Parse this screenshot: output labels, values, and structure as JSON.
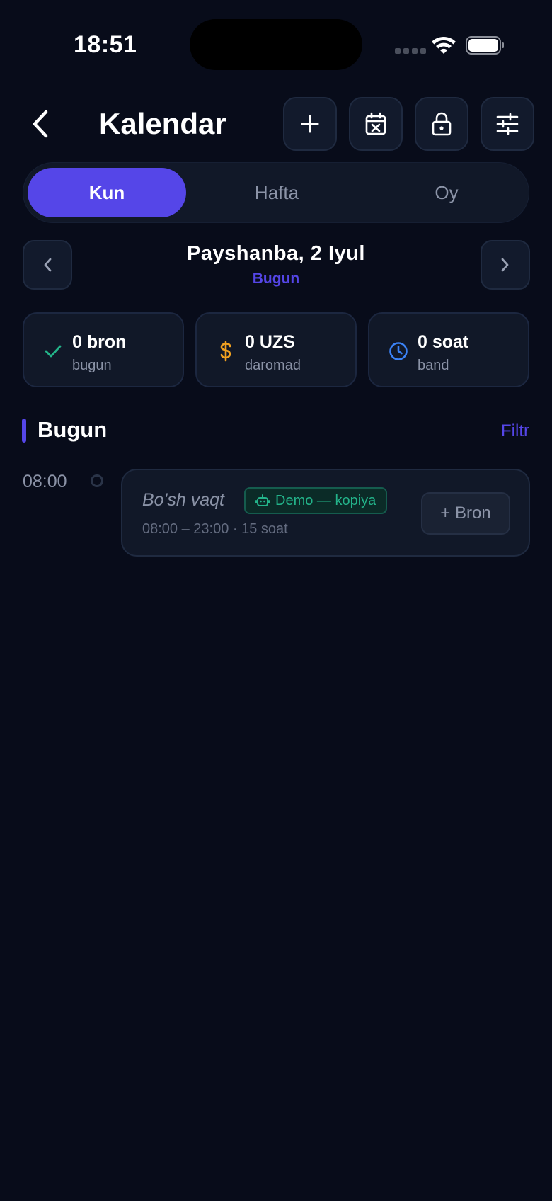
{
  "status_bar": {
    "time": "18:51"
  },
  "header": {
    "title": "Kalendar",
    "icons": [
      "back-chevron-icon",
      "plus-icon",
      "calendar-x-icon",
      "lock-icon",
      "sliders-icon"
    ]
  },
  "tabs": [
    {
      "label": "Kun",
      "active": true
    },
    {
      "label": "Hafta",
      "active": false
    },
    {
      "label": "Oy",
      "active": false
    }
  ],
  "date_nav": {
    "date": "Payshanba, 2 Iyul",
    "relative": "Bugun"
  },
  "stats": [
    {
      "value": "0 bron",
      "label": "bugun",
      "icon": "check-icon",
      "color": "#23b48a"
    },
    {
      "value": "0 UZS",
      "label": "daromad",
      "icon": "dollar-icon",
      "color": "#f0a020"
    },
    {
      "value": "0 soat",
      "label": "band",
      "icon": "clock-icon",
      "color": "#3b82f6"
    }
  ],
  "section": {
    "title": "Bugun",
    "filter_label": "Filtr"
  },
  "timeline": [
    {
      "time": "08:00",
      "title": "Bo'sh vaqt",
      "badge": "Demo — kopiya",
      "range": "08:00 – 23:00 · 15 soat",
      "action": "+ Bron"
    }
  ],
  "colors": {
    "accent": "#5546e8",
    "background": "#080c1a",
    "card": "#111828",
    "badge_green": "#23b48a"
  }
}
